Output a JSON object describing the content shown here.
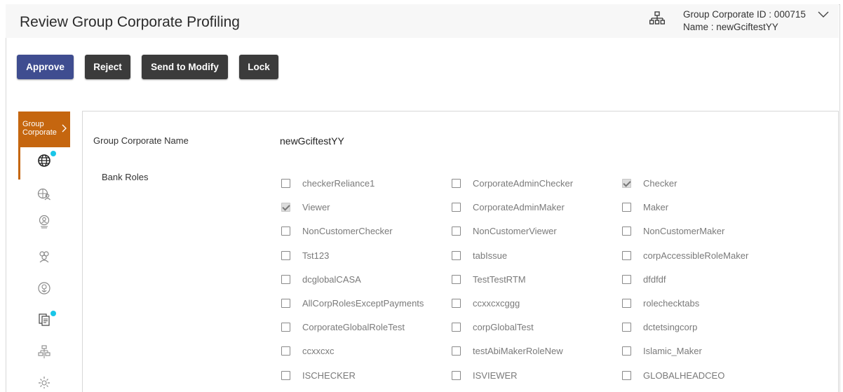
{
  "header": {
    "title": "Review Group Corporate Profiling",
    "corporate_id": "Group Corporate ID : 000715",
    "corporate_name": "Name : newGciftestYY"
  },
  "actions": {
    "approve": "Approve",
    "reject": "Reject",
    "send_to_modify": "Send to Modify",
    "lock": "Lock"
  },
  "sidebar": {
    "tab_line1": "Group",
    "tab_line2": "Corporate",
    "icons": [
      "globe-icon",
      "globe-users-icon",
      "user-badge-icon",
      "group-icon",
      "support-icon",
      "documents-icon",
      "hierarchy-icon",
      "settings-icon"
    ]
  },
  "form": {
    "name_label": "Group Corporate Name",
    "name_value": "newGciftestYY",
    "roles_label": "Bank Roles",
    "roles": [
      {
        "label": "checkerReliance1",
        "checked": false
      },
      {
        "label": "CorporateAdminChecker",
        "checked": false
      },
      {
        "label": "Checker",
        "checked": true
      },
      {
        "label": "Viewer",
        "checked": true
      },
      {
        "label": "CorporateAdminMaker",
        "checked": false
      },
      {
        "label": "Maker",
        "checked": false
      },
      {
        "label": "NonCustomerChecker",
        "checked": false
      },
      {
        "label": "NonCustomerViewer",
        "checked": false
      },
      {
        "label": "NonCustomerMaker",
        "checked": false
      },
      {
        "label": "Tst123",
        "checked": false
      },
      {
        "label": "tabIssue",
        "checked": false
      },
      {
        "label": "corpAccessibleRoleMaker",
        "checked": false
      },
      {
        "label": "dcglobalCASA",
        "checked": false
      },
      {
        "label": "TestTestRTM",
        "checked": false
      },
      {
        "label": "dfdfdf",
        "checked": false
      },
      {
        "label": "AllCorpRolesExceptPayments",
        "checked": false
      },
      {
        "label": "ccxxcxcggg",
        "checked": false
      },
      {
        "label": "rolechecktabs",
        "checked": false
      },
      {
        "label": "CorporateGlobalRoleTest",
        "checked": false
      },
      {
        "label": "corpGlobalTest",
        "checked": false
      },
      {
        "label": "dctetsingcorp",
        "checked": false
      },
      {
        "label": "ccxxcxc",
        "checked": false
      },
      {
        "label": "testAbiMakerRoleNew",
        "checked": false
      },
      {
        "label": "Islamic_Maker",
        "checked": false
      },
      {
        "label": "ISCHECKER",
        "checked": false
      },
      {
        "label": "ISVIEWER",
        "checked": false
      },
      {
        "label": "GLOBALHEADCEO",
        "checked": false
      }
    ]
  },
  "colors": {
    "approve": "#3f4d90",
    "secondary_button": "#3b3b3b",
    "accent_tab": "#c5660f",
    "notification_dot": "#19c6e8"
  }
}
